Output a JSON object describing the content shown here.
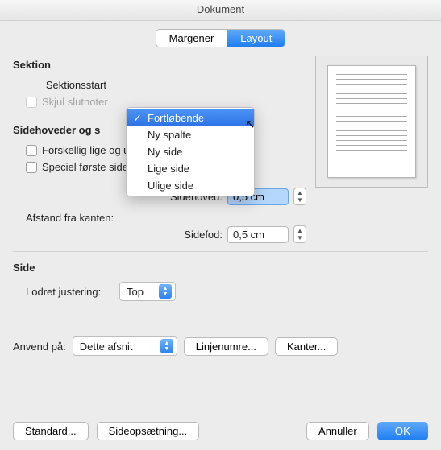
{
  "title": "Dokument",
  "tabs": {
    "margins": "Margener",
    "layout": "Layout"
  },
  "section": {
    "heading": "Sektion",
    "start_label": "Sektionsstart",
    "start_selected": "Fortløbende",
    "hide_endnotes": "Skjul slutnoter",
    "start_options": [
      "Fortløbende",
      "Ny spalte",
      "Ny side",
      "Lige side",
      "Ulige side"
    ]
  },
  "headers": {
    "heading_truncated": "Sidehoveder og s",
    "diff_odd_even": "Forskellig lige og ulige",
    "special_first": "Speciel første side",
    "distance_label": "Afstand fra kanten:",
    "header_label": "Sidehoved:",
    "footer_label": "Sidefod:",
    "header_value": "0,5 cm",
    "footer_value": "0,5 cm"
  },
  "page": {
    "heading": "Side",
    "valign_label": "Lodret justering:",
    "valign_value": "Top"
  },
  "apply": {
    "label": "Anvend på:",
    "value": "Dette afsnit",
    "linenumbers": "Linjenumre...",
    "borders": "Kanter..."
  },
  "buttons": {
    "default": "Standard...",
    "pagesetup": "Sideopsætning...",
    "cancel": "Annuller",
    "ok": "OK"
  }
}
